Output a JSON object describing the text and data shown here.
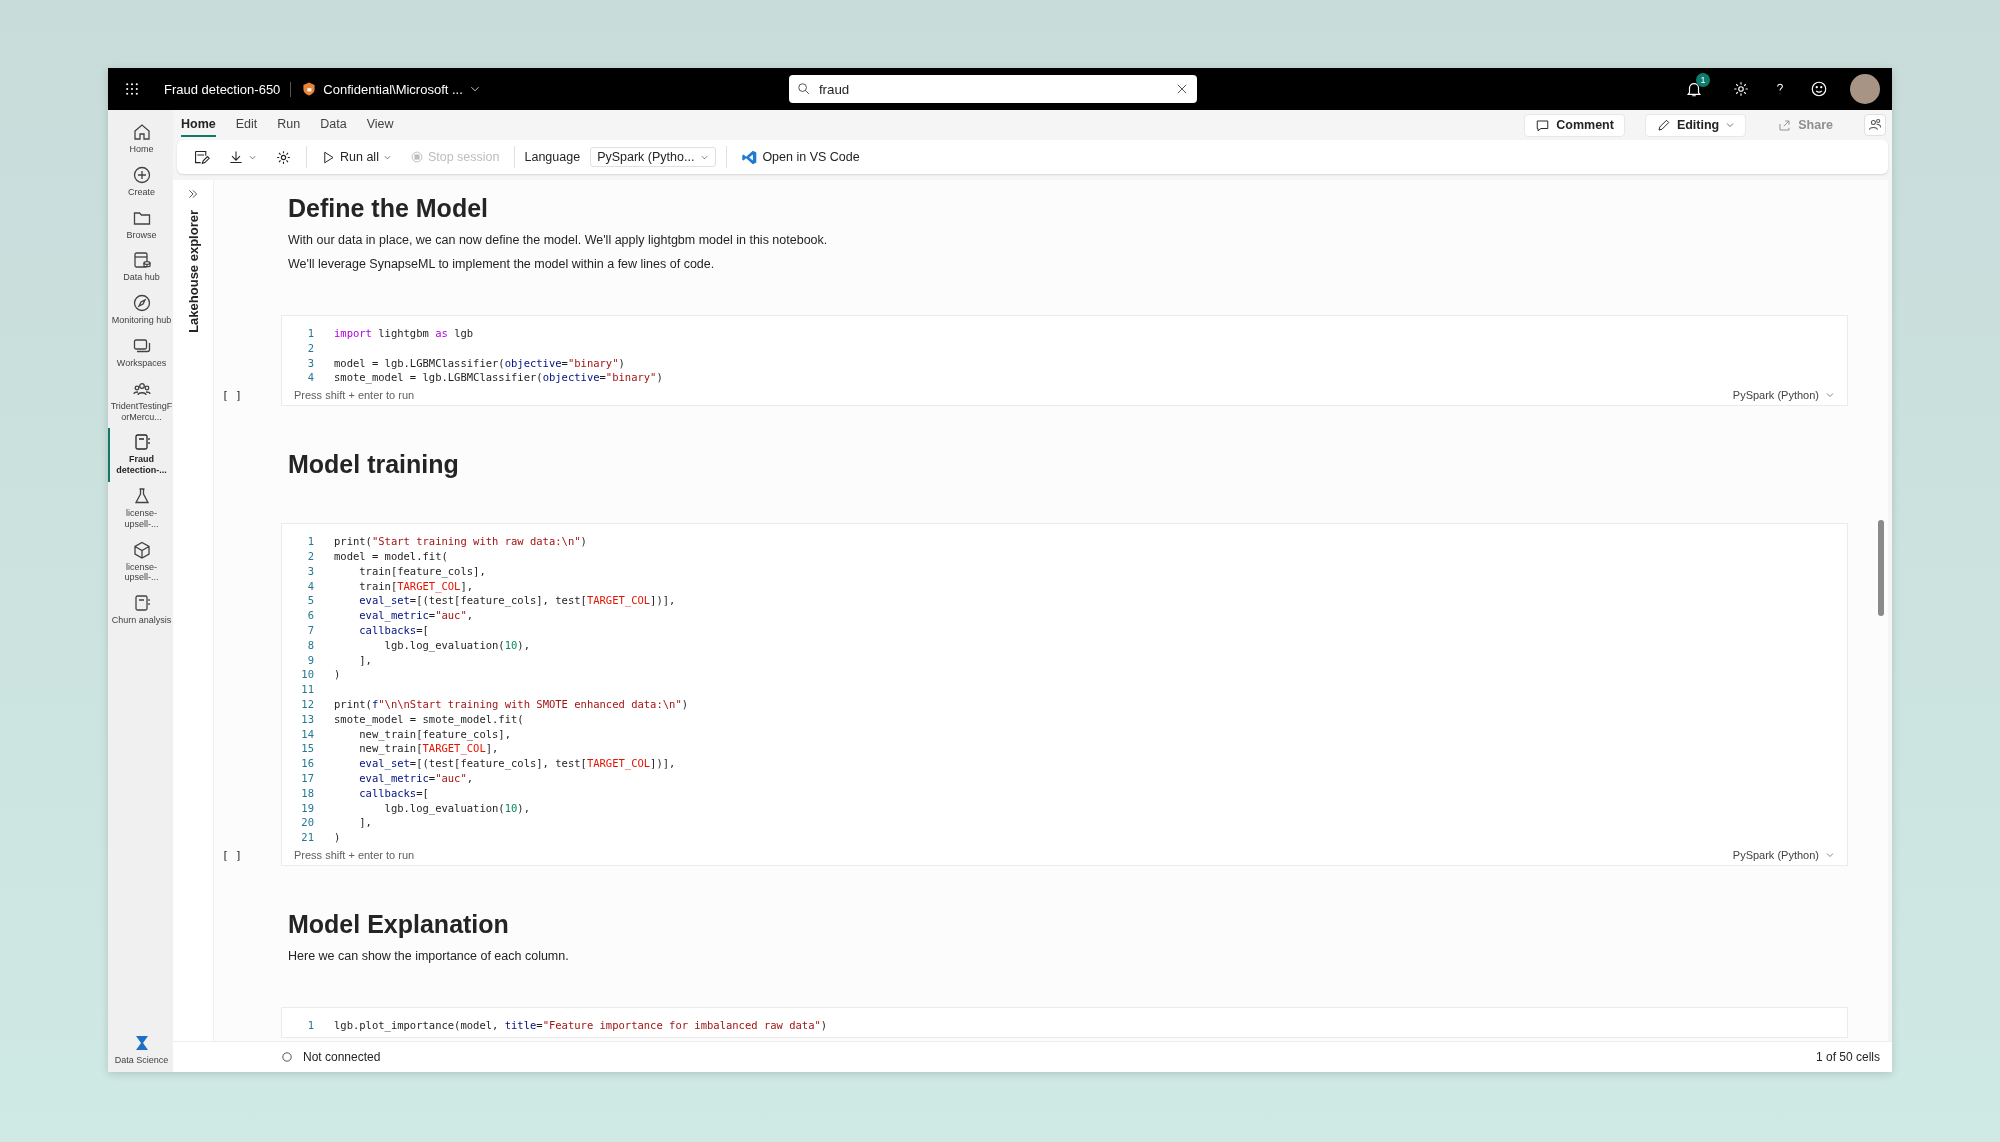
{
  "topbar": {
    "title": "Fraud detection-650",
    "sensitivity": "Confidential\\Microsoft ...",
    "search": {
      "value": "fraud"
    },
    "notification_count": "1"
  },
  "ribbon": {
    "tabs": [
      {
        "label": "Home",
        "selected": true
      },
      {
        "label": "Edit",
        "selected": false
      },
      {
        "label": "Run",
        "selected": false
      },
      {
        "label": "Data",
        "selected": false
      },
      {
        "label": "View",
        "selected": false
      }
    ],
    "run_all": "Run all",
    "stop_session": {
      "label": "Stop session",
      "disabled": true
    },
    "language_label": "Language",
    "language_value": "PySpark (Pytho...",
    "vscode": "Open in VS Code",
    "comment": "Comment",
    "editing": "Editing",
    "share": {
      "label": "Share",
      "disabled": true
    }
  },
  "sidebar": {
    "items": [
      {
        "label": "Home",
        "kind": "home",
        "selected": false
      },
      {
        "label": "Create",
        "kind": "create",
        "selected": false
      },
      {
        "label": "Browse",
        "kind": "browse",
        "selected": false
      },
      {
        "label": "Data hub",
        "kind": "datahub",
        "selected": false
      },
      {
        "label": "Monitoring hub",
        "kind": "monitor",
        "selected": false
      },
      {
        "label": "Workspaces",
        "kind": "workspaces",
        "selected": false
      },
      {
        "label": "TridentTestingForMercu...",
        "kind": "group",
        "selected": false
      },
      {
        "label": "Fraud detection-...",
        "kind": "notebook",
        "selected": true
      },
      {
        "label": "license-upsell-...",
        "kind": "flask",
        "selected": false
      },
      {
        "label": "license-upsell-...",
        "kind": "cube",
        "selected": false
      },
      {
        "label": "Churn analysis",
        "kind": "notebook",
        "selected": false
      }
    ],
    "bottom": "Data Science"
  },
  "side_panel": {
    "title": "Lakehouse explorer"
  },
  "cells": [
    {
      "kind": "markdown",
      "heading": "Define the Model",
      "paragraphs": [
        "With our data in place, we can now define the model. We'll apply lightgbm model in this notebook.",
        "We'll leverage SynapseML to implement the model within a few lines of code."
      ]
    },
    {
      "kind": "code",
      "run_marker": "[ ]",
      "hint": "Press shift + enter to run",
      "language": "PySpark (Python)",
      "lines": [
        {
          "number": "1",
          "tokens": [
            {
              "text": "import",
              "kind": "keyword"
            },
            {
              "text": " lightgbm ",
              "kind": "plain"
            },
            {
              "text": "as",
              "kind": "keyword"
            },
            {
              "text": " lgb",
              "kind": "plain"
            }
          ]
        },
        {
          "number": "2"
        },
        {
          "number": "3",
          "tokens": [
            {
              "text": "model = lgb.LGBMClassifier(",
              "kind": "plain"
            },
            {
              "text": "objective",
              "kind": "param"
            },
            {
              "text": "=",
              "kind": "plain"
            },
            {
              "text": "\"binary\"",
              "kind": "string"
            },
            {
              "text": ")",
              "kind": "plain"
            }
          ]
        },
        {
          "number": "4",
          "tokens": [
            {
              "text": "smote_model = lgb.LGBMClassifier(",
              "kind": "plain"
            },
            {
              "text": "objective",
              "kind": "param"
            },
            {
              "text": "=",
              "kind": "plain"
            },
            {
              "text": "\"binary\"",
              "kind": "string"
            },
            {
              "text": ")",
              "kind": "plain"
            }
          ]
        }
      ]
    },
    {
      "kind": "markdown",
      "heading": "Model training"
    },
    {
      "kind": "code",
      "run_marker": "[ ]",
      "hint": "Press shift + enter to run",
      "language": "PySpark (Python)",
      "lines": [
        {
          "number": "1",
          "tokens": [
            {
              "text": "print(",
              "kind": "plain"
            },
            {
              "text": "\"Start training with raw data:\\n\"",
              "kind": "string"
            },
            {
              "text": ")",
              "kind": "plain"
            }
          ]
        },
        {
          "number": "2",
          "tokens": [
            {
              "text": "model = model.fit(",
              "kind": "plain"
            }
          ]
        },
        {
          "number": "3",
          "tokens": [
            {
              "text": "    train[feature_cols],",
              "kind": "plain"
            }
          ]
        },
        {
          "number": "4",
          "tokens": [
            {
              "text": "    train[",
              "kind": "plain"
            },
            {
              "text": "TARGET_COL",
              "kind": "const"
            },
            {
              "text": "],",
              "kind": "plain"
            }
          ]
        },
        {
          "number": "5",
          "tokens": [
            {
              "text": "    eval_set",
              "kind": "param"
            },
            {
              "text": "=[(test[feature_cols], test[",
              "kind": "plain"
            },
            {
              "text": "TARGET_COL",
              "kind": "const"
            },
            {
              "text": "])],",
              "kind": "plain"
            }
          ]
        },
        {
          "number": "6",
          "tokens": [
            {
              "text": "    eval_metric",
              "kind": "param"
            },
            {
              "text": "=",
              "kind": "plain"
            },
            {
              "text": "\"auc\"",
              "kind": "string"
            },
            {
              "text": ",",
              "kind": "plain"
            }
          ]
        },
        {
          "number": "7",
          "tokens": [
            {
              "text": "    callbacks",
              "kind": "param"
            },
            {
              "text": "=[",
              "kind": "plain"
            }
          ]
        },
        {
          "number": "8",
          "tokens": [
            {
              "text": "        lgb.log_evaluation(",
              "kind": "plain"
            },
            {
              "text": "10",
              "kind": "number"
            },
            {
              "text": "),",
              "kind": "plain"
            }
          ]
        },
        {
          "number": "9",
          "tokens": [
            {
              "text": "    ],",
              "kind": "plain"
            }
          ]
        },
        {
          "number": "10",
          "tokens": [
            {
              "text": ")",
              "kind": "plain"
            }
          ]
        },
        {
          "number": "11"
        },
        {
          "number": "12",
          "tokens": [
            {
              "text": "print(",
              "kind": "plain"
            },
            {
              "text": "f",
              "kind": "param"
            },
            {
              "text": "\"\\n\\nStart training with SMOTE enhanced data:\\n\"",
              "kind": "string"
            },
            {
              "text": ")",
              "kind": "plain"
            }
          ]
        },
        {
          "number": "13",
          "tokens": [
            {
              "text": "smote_model = smote_model.fit(",
              "kind": "plain"
            }
          ]
        },
        {
          "number": "14",
          "tokens": [
            {
              "text": "    new_train[feature_cols],",
              "kind": "plain"
            }
          ]
        },
        {
          "number": "15",
          "tokens": [
            {
              "text": "    new_train[",
              "kind": "plain"
            },
            {
              "text": "TARGET_COL",
              "kind": "const"
            },
            {
              "text": "],",
              "kind": "plain"
            }
          ]
        },
        {
          "number": "16",
          "tokens": [
            {
              "text": "    eval_set",
              "kind": "param"
            },
            {
              "text": "=[(test[feature_cols], test[",
              "kind": "plain"
            },
            {
              "text": "TARGET_COL",
              "kind": "const"
            },
            {
              "text": "])],",
              "kind": "plain"
            }
          ]
        },
        {
          "number": "17",
          "tokens": [
            {
              "text": "    eval_metric",
              "kind": "param"
            },
            {
              "text": "=",
              "kind": "plain"
            },
            {
              "text": "\"auc\"",
              "kind": "string"
            },
            {
              "text": ",",
              "kind": "plain"
            }
          ]
        },
        {
          "number": "18",
          "tokens": [
            {
              "text": "    callbacks",
              "kind": "param"
            },
            {
              "text": "=[",
              "kind": "plain"
            }
          ]
        },
        {
          "number": "19",
          "tokens": [
            {
              "text": "        lgb.log_evaluation(",
              "kind": "plain"
            },
            {
              "text": "10",
              "kind": "number"
            },
            {
              "text": "),",
              "kind": "plain"
            }
          ]
        },
        {
          "number": "20",
          "tokens": [
            {
              "text": "    ],",
              "kind": "plain"
            }
          ]
        },
        {
          "number": "21",
          "tokens": [
            {
              "text": ")",
              "kind": "plain"
            }
          ]
        }
      ]
    },
    {
      "kind": "markdown",
      "heading": "Model Explanation",
      "paragraphs": [
        "Here we can show the importance of each column."
      ]
    },
    {
      "kind": "code",
      "lines": [
        {
          "number": "1",
          "tokens": [
            {
              "text": "lgb.plot_importance(model, ",
              "kind": "plain"
            },
            {
              "text": "title",
              "kind": "param"
            },
            {
              "text": "=",
              "kind": "plain"
            },
            {
              "text": "\"Feature importance for imbalanced raw data\"",
              "kind": "string"
            },
            {
              "text": ")",
              "kind": "plain"
            }
          ]
        }
      ]
    }
  ],
  "status_bar": {
    "connection": "Not connected",
    "cell_count": "1 of 50 cells"
  }
}
